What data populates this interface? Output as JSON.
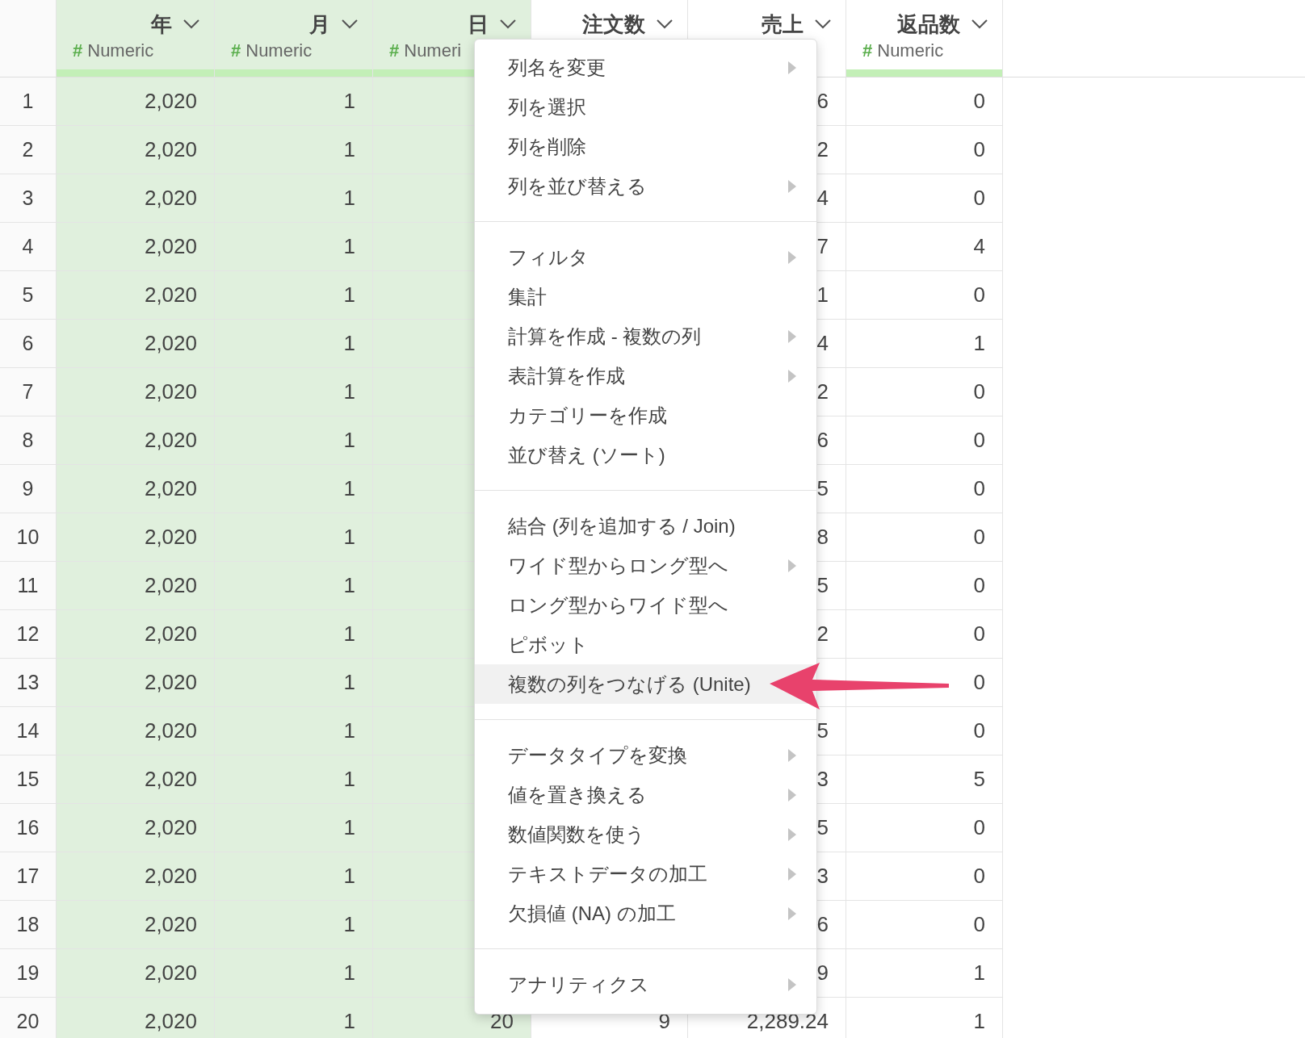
{
  "columns": [
    {
      "name": "年",
      "type_icon": "#",
      "type": "Numeric",
      "selected": true
    },
    {
      "name": "月",
      "type_icon": "#",
      "type": "Numeric",
      "selected": true
    },
    {
      "name": "日",
      "type_icon": "#",
      "type": "Numeri",
      "selected": true
    },
    {
      "name": "注文数",
      "selected": false
    },
    {
      "name": "売上",
      "selected": false
    },
    {
      "name": "返品数",
      "type_icon": "#",
      "type": "Numeric",
      "selected": false
    }
  ],
  "rows": [
    {
      "number": "1",
      "cells": [
        "2,020",
        "1",
        null,
        null,
        "6",
        "0"
      ]
    },
    {
      "number": "2",
      "cells": [
        "2,020",
        "1",
        null,
        null,
        "2",
        "0"
      ]
    },
    {
      "number": "3",
      "cells": [
        "2,020",
        "1",
        null,
        null,
        "4",
        "0"
      ]
    },
    {
      "number": "4",
      "cells": [
        "2,020",
        "1",
        null,
        null,
        "7",
        "4"
      ]
    },
    {
      "number": "5",
      "cells": [
        "2,020",
        "1",
        null,
        null,
        "1",
        "0"
      ]
    },
    {
      "number": "6",
      "cells": [
        "2,020",
        "1",
        null,
        null,
        "4",
        "1"
      ]
    },
    {
      "number": "7",
      "cells": [
        "2,020",
        "1",
        null,
        null,
        "2",
        "0"
      ]
    },
    {
      "number": "8",
      "cells": [
        "2,020",
        "1",
        null,
        null,
        "6",
        "0"
      ]
    },
    {
      "number": "9",
      "cells": [
        "2,020",
        "1",
        null,
        null,
        "5",
        "0"
      ]
    },
    {
      "number": "10",
      "cells": [
        "2,020",
        "1",
        null,
        null,
        "8",
        "0"
      ]
    },
    {
      "number": "11",
      "cells": [
        "2,020",
        "1",
        null,
        null,
        "5",
        "0"
      ]
    },
    {
      "number": "12",
      "cells": [
        "2,020",
        "1",
        null,
        null,
        "2",
        "0"
      ]
    },
    {
      "number": "13",
      "cells": [
        "2,020",
        "1",
        null,
        null,
        null,
        "0"
      ]
    },
    {
      "number": "14",
      "cells": [
        "2,020",
        "1",
        null,
        null,
        "5",
        "0"
      ]
    },
    {
      "number": "15",
      "cells": [
        "2,020",
        "1",
        null,
        null,
        "3",
        "5"
      ]
    },
    {
      "number": "16",
      "cells": [
        "2,020",
        "1",
        null,
        null,
        "5",
        "0"
      ]
    },
    {
      "number": "17",
      "cells": [
        "2,020",
        "1",
        null,
        null,
        "3",
        "0"
      ]
    },
    {
      "number": "18",
      "cells": [
        "2,020",
        "1",
        null,
        null,
        "6",
        "0"
      ]
    },
    {
      "number": "19",
      "cells": [
        "2,020",
        "1",
        null,
        null,
        "9",
        "1"
      ]
    },
    {
      "number": "20",
      "cells": [
        "2,020",
        "1",
        "20",
        "9",
        "2,289.24",
        "1"
      ]
    }
  ],
  "context_menu": {
    "sections": [
      [
        {
          "label": "列名を変更",
          "submenu": true,
          "selected": false
        },
        {
          "label": "列を選択",
          "submenu": false,
          "selected": false
        },
        {
          "label": "列を削除",
          "submenu": false,
          "selected": false
        },
        {
          "label": "列を並び替える",
          "submenu": true,
          "selected": false
        }
      ],
      [
        {
          "label": "フィルタ",
          "submenu": true,
          "selected": false
        },
        {
          "label": "集計",
          "submenu": false,
          "selected": false
        },
        {
          "label": "計算を作成 - 複数の列",
          "submenu": true,
          "selected": false
        },
        {
          "label": "表計算を作成",
          "submenu": true,
          "selected": false
        },
        {
          "label": "カテゴリーを作成",
          "submenu": false,
          "selected": false
        },
        {
          "label": "並び替え (ソート)",
          "submenu": false,
          "selected": false
        }
      ],
      [
        {
          "label": "結合 (列を追加する / Join)",
          "submenu": false,
          "selected": false
        },
        {
          "label": "ワイド型からロング型へ",
          "submenu": true,
          "selected": false
        },
        {
          "label": "ロング型からワイド型へ",
          "submenu": false,
          "selected": false
        },
        {
          "label": "ピボット",
          "submenu": false,
          "selected": false
        },
        {
          "label": "複数の列をつなげる (Unite)",
          "submenu": false,
          "selected": true
        }
      ],
      [
        {
          "label": "データタイプを変換",
          "submenu": true,
          "selected": false
        },
        {
          "label": "値を置き換える",
          "submenu": true,
          "selected": false
        },
        {
          "label": "数値関数を使う",
          "submenu": true,
          "selected": false
        },
        {
          "label": "テキストデータの加工",
          "submenu": true,
          "selected": false
        },
        {
          "label": "欠損値 (NA) の加工",
          "submenu": true,
          "selected": false
        }
      ],
      [
        {
          "label": "アナリティクス",
          "submenu": true,
          "selected": false
        }
      ]
    ]
  }
}
